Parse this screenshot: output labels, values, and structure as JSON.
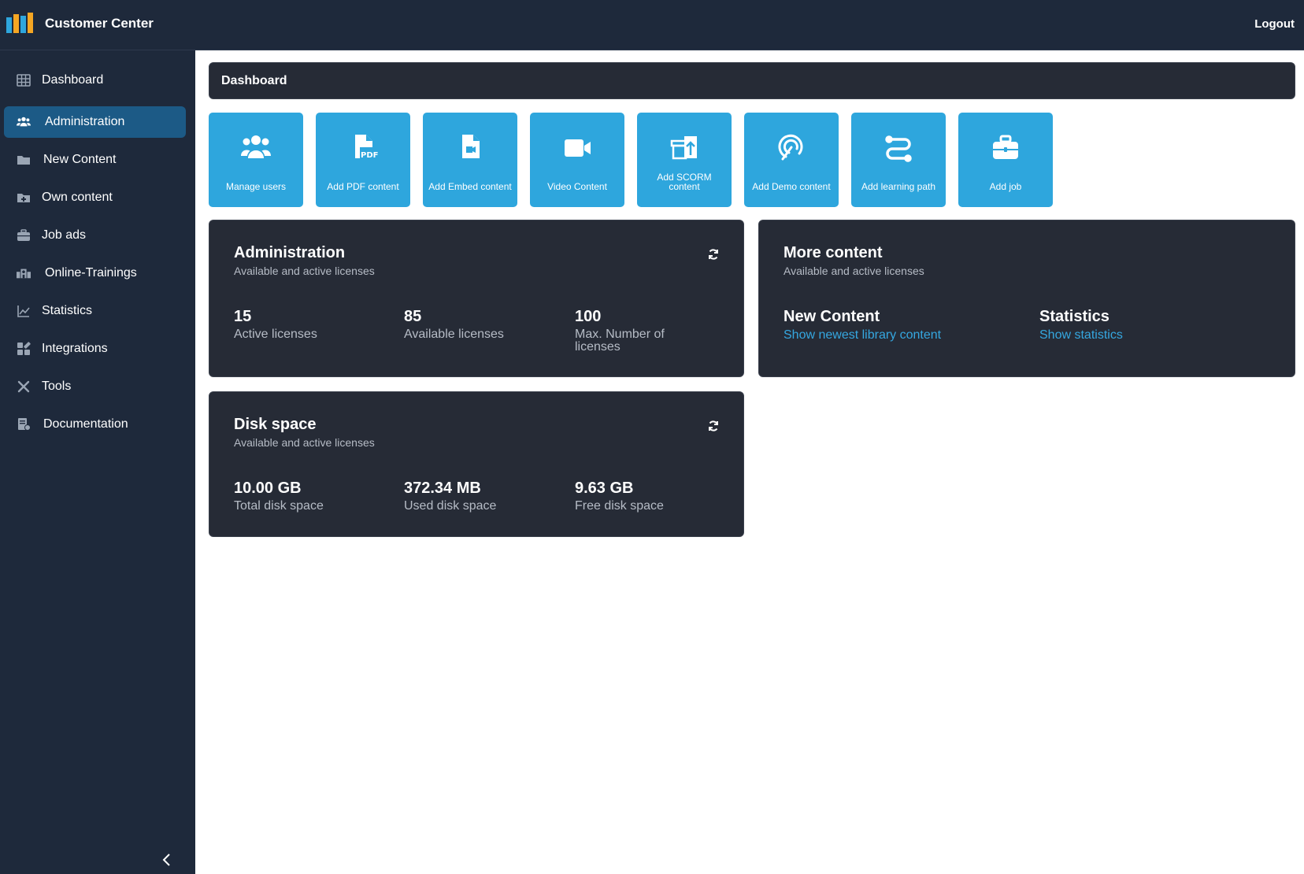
{
  "app": {
    "title": "Customer Center",
    "logout": "Logout"
  },
  "sidebar": {
    "items": [
      {
        "label": "Dashboard",
        "icon": "grid-icon"
      },
      {
        "label": "Administration",
        "icon": "users-icon"
      },
      {
        "label": "New Content",
        "icon": "folder-icon"
      },
      {
        "label": "Own content",
        "icon": "folder-plus-icon"
      },
      {
        "label": "Job ads",
        "icon": "briefcase-icon"
      },
      {
        "label": "Online-Trainings",
        "icon": "school-icon"
      },
      {
        "label": "Statistics",
        "icon": "chart-icon"
      },
      {
        "label": "Integrations",
        "icon": "puzzle-icon"
      },
      {
        "label": "Tools",
        "icon": "tools-icon"
      },
      {
        "label": "Documentation",
        "icon": "document-icon"
      }
    ]
  },
  "page": {
    "title": "Dashboard"
  },
  "tiles": [
    {
      "label": "Manage users",
      "icon": "users-icon"
    },
    {
      "label": "Add PDF content",
      "icon": "pdf-icon"
    },
    {
      "label": "Add Embed content",
      "icon": "embed-file-icon"
    },
    {
      "label": "Video Content",
      "icon": "video-icon"
    },
    {
      "label": "Add SCORM content",
      "icon": "scorm-upload-icon"
    },
    {
      "label": "Add Demo content",
      "icon": "demo-target-icon"
    },
    {
      "label": "Add learning path",
      "icon": "route-icon"
    },
    {
      "label": "Add job",
      "icon": "briefcase-icon"
    }
  ],
  "admin_card": {
    "title": "Administration",
    "subtitle": "Available and active licenses",
    "stats": [
      {
        "value": "15",
        "label": "Active licenses"
      },
      {
        "value": "85",
        "label": "Available licenses"
      },
      {
        "value": "100",
        "label": "Max. Number of licenses"
      }
    ]
  },
  "more_card": {
    "title": "More content",
    "subtitle": "Available and active licenses",
    "items": [
      {
        "title": "New Content",
        "link": "Show newest library content"
      },
      {
        "title": "Statistics",
        "link": "Show statistics"
      }
    ]
  },
  "disk_card": {
    "title": "Disk space",
    "subtitle": "Available and active licenses",
    "stats": [
      {
        "value": "10.00 GB",
        "label": "Total disk space"
      },
      {
        "value": "372.34 MB",
        "label": "Used disk space"
      },
      {
        "value": "9.63 GB",
        "label": "Free disk space"
      }
    ]
  },
  "colors": {
    "sidebar_bg": "#1e293b",
    "active_item": "#1c5a86",
    "tile_blue": "#2ea6dd",
    "card_bg": "#262b36",
    "link": "#35a7e0"
  }
}
